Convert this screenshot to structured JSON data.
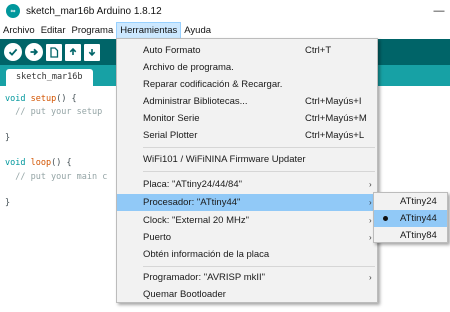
{
  "window": {
    "title": "sketch_mar16b Arduino 1.8.12",
    "minimize_glyph": "—"
  },
  "menubar": {
    "items": [
      "Archivo",
      "Editar",
      "Programa",
      "Herramientas",
      "Ayuda"
    ]
  },
  "toolbar": {
    "buttons": [
      "verify-icon",
      "upload-icon",
      "new-icon",
      "open-icon",
      "save-icon"
    ]
  },
  "tabs": [
    {
      "label": "sketch_mar16b"
    }
  ],
  "editor": {
    "lines": [
      {
        "keyword": "void",
        "name": "setup",
        "rest": "() {"
      },
      {
        "comment": "  // put your setup"
      },
      {
        "keyword": "void",
        "name": "loop",
        "rest": "() {"
      },
      {
        "comment": "  // put your main c"
      },
      {
        "close": "}"
      }
    ],
    "close_1": "}"
  },
  "tools_menu": {
    "items": [
      {
        "label": "Auto Formato",
        "shortcut": "Ctrl+T"
      },
      {
        "label": "Archivo de programa.",
        "shortcut": ""
      },
      {
        "label": "Reparar codificación & Recargar.",
        "shortcut": ""
      },
      {
        "label": "Administrar Bibliotecas...",
        "shortcut": "Ctrl+Mayús+I"
      },
      {
        "label": "Monitor Serie",
        "shortcut": "Ctrl+Mayús+M"
      },
      {
        "label": "Serial Plotter",
        "shortcut": "Ctrl+Mayús+L"
      },
      {
        "label": "WiFi101 / WiFiNINA Firmware Updater",
        "shortcut": ""
      },
      {
        "label": "Placa: \"ATtiny24/44/84\"",
        "shortcut": "",
        "arrow": "›"
      },
      {
        "label": "Procesador: \"ATtiny44\"",
        "shortcut": "",
        "arrow": "›"
      },
      {
        "label": "Clock: \"External 20 MHz\"",
        "shortcut": "",
        "arrow": "›"
      },
      {
        "label": "Puerto",
        "shortcut": "",
        "arrow": "›"
      },
      {
        "label": "Obtén información de la placa",
        "shortcut": ""
      },
      {
        "label": "Programador: \"AVRISP mkII\"",
        "shortcut": "",
        "arrow": "›"
      },
      {
        "label": "Quemar Bootloader",
        "shortcut": ""
      }
    ],
    "highlighted_index": 8
  },
  "processor_submenu": {
    "items": [
      "ATtiny24",
      "ATtiny44",
      "ATtiny84"
    ],
    "selected": "ATtiny44"
  },
  "colors": {
    "toolbar": "#006468",
    "tabstrip": "#17a1a5",
    "highlight": "#91c9f7",
    "menu_bg": "#f2f2f2"
  }
}
